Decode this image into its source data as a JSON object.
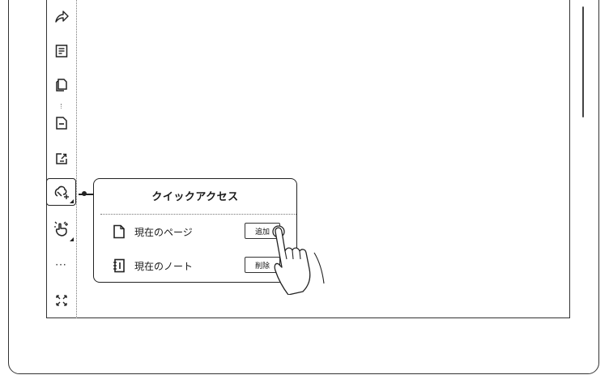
{
  "toolbar": {
    "items": [
      {
        "icon": "share-icon"
      },
      {
        "icon": "document-icon"
      },
      {
        "icon": "copy-pages-icon"
      },
      {
        "icon": "page-minus-icon"
      },
      {
        "icon": "export-icon"
      },
      {
        "icon": "quick-access-icon",
        "active": true
      },
      {
        "icon": "gesture-icon"
      },
      {
        "icon": "more-icon",
        "label": "···"
      },
      {
        "icon": "fullscreen-icon"
      }
    ]
  },
  "quick_access": {
    "title": "クイックアクセス",
    "rows": [
      {
        "label": "現在のページ",
        "button": "追加",
        "icon": "page-icon"
      },
      {
        "label": "現在のノート",
        "button": "削除",
        "icon": "notebook-icon"
      }
    ]
  }
}
